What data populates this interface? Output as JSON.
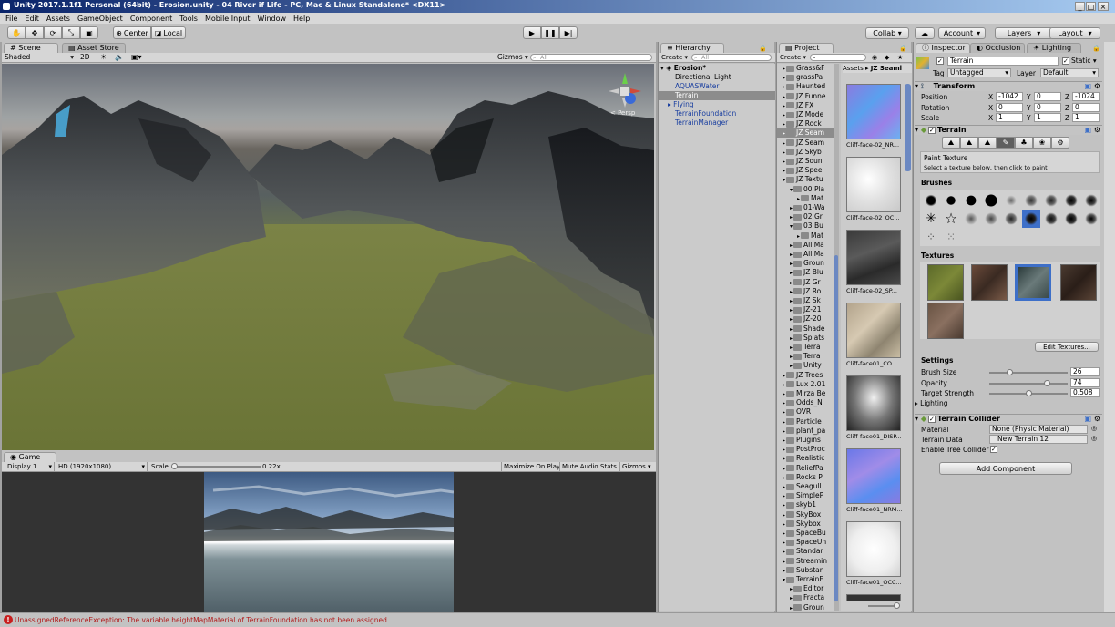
{
  "window": {
    "title": "Unity 2017.1.1f1 Personal (64bit) - Erosion.unity - 04 River if Life - PC, Mac & Linux Standalone* <DX11>"
  },
  "menu": [
    "File",
    "Edit",
    "Assets",
    "GameObject",
    "Component",
    "Tools",
    "Mobile Input",
    "Window",
    "Help"
  ],
  "toolbar": {
    "center": "Center",
    "local": "Local",
    "collab": "Collab ▾",
    "account": "Account",
    "layers": "Layers",
    "layout": "Layout"
  },
  "scene": {
    "tab": "Scene",
    "asset_store_tab": "Asset Store",
    "shading": "Shaded",
    "mode_2d": "2D",
    "gizmos": "Gizmos",
    "search_placeholder": "All",
    "persp": "< Persp"
  },
  "game": {
    "tab": "Game",
    "display": "Display 1",
    "resolution": "HD (1920x1080)",
    "scale_label": "Scale",
    "scale_value": "0.22x",
    "maximize": "Maximize On Play",
    "mute": "Mute Audio",
    "stats": "Stats",
    "gizmos": "Gizmos"
  },
  "hierarchy": {
    "tab": "Hierarchy",
    "create": "Create",
    "search": "All",
    "scene": "Erosion*",
    "items": [
      "Directional Light",
      "AQUASWater",
      "Terrain",
      "Flying",
      "TerrainFoundation",
      "TerrainManager"
    ]
  },
  "project": {
    "tab": "Project",
    "create": "Create",
    "path": [
      "Assets",
      "JZ Seaml"
    ],
    "folders": [
      "Grass&F",
      "grassPa",
      "Haunted",
      "JZ Funne",
      "JZ FX",
      "JZ Mode",
      "JZ Rock",
      "JZ Seam",
      "JZ Seam",
      "JZ Skyb",
      "JZ Soun",
      "JZ Spee",
      "JZ Textu",
      "00 Pla",
      "Mat",
      "01-Wa",
      "02 Gr",
      "03 Bu",
      "Mat",
      "All Ma",
      "All Ma",
      "Groun",
      "JZ Blu",
      "JZ Gr",
      "JZ Ro",
      "JZ Sk",
      "JZ-21",
      "JZ-20",
      "Shade",
      "Splats",
      "Terra",
      "Terra",
      "Unity",
      "JZ Trees",
      "Lux 2.01",
      "Mirza Be",
      "Odds_N",
      "OVR",
      "Particle",
      "plant_pa",
      "Plugins",
      "PostProc",
      "Realistic",
      "ReliefPa",
      "Rocks P",
      "Seagull",
      "SimpleP",
      "skyb1",
      "SkyBox",
      "Skybox",
      "SpaceBu",
      "SpaceUn",
      "Standar",
      "Streamin",
      "Substan",
      "TerrainF",
      "Editor",
      "Fracta",
      "Groun"
    ],
    "assets": [
      "Cliff-face-02_NR...",
      "Cliff-face-02_OC...",
      "Cliff-face-02_SP...",
      "Cliff-face01_CO...",
      "Cliff-face01_DISP...",
      "Cliff-face01_NRM...",
      "Cliff-face01_OCC..."
    ]
  },
  "inspector": {
    "tabs": [
      "Inspector",
      "Occlusion",
      "Lighting"
    ],
    "name": "Terrain",
    "static": "Static",
    "tag_label": "Tag",
    "tag": "Untagged",
    "layer_label": "Layer",
    "layer": "Default",
    "transform": {
      "title": "Transform",
      "position_label": "Position",
      "rotation_label": "Rotation",
      "scale_label": "Scale",
      "pos": [
        "-1042",
        "0",
        "-1024"
      ],
      "rot": [
        "0",
        "0",
        "0"
      ],
      "scl": [
        "1",
        "1",
        "1"
      ],
      "axes": [
        "X",
        "Y",
        "Z"
      ]
    },
    "terrain": {
      "title": "Terrain",
      "paint_title": "Paint Texture",
      "paint_hint": "Select a texture below, then click to paint",
      "brushes_label": "Brushes",
      "textures_label": "Textures",
      "edit_textures": "Edit Textures...",
      "settings_label": "Settings",
      "brush_size_label": "Brush Size",
      "brush_size": "26",
      "opacity_label": "Opacity",
      "opacity": "74",
      "target_label": "Target Strength",
      "target": "0.508",
      "lighting_label": "Lighting"
    },
    "collider": {
      "title": "Terrain Collider",
      "material_label": "Material",
      "material": "None (Physic Material)",
      "data_label": "Terrain Data",
      "data": "New Terrain 12",
      "tree_label": "Enable Tree Collider"
    },
    "add_component": "Add Component"
  },
  "status": {
    "error": "UnassignedReferenceException: The variable heightMapMaterial of TerrainFoundation has not been assigned."
  },
  "colors": {
    "selection": "#3d6fc8",
    "title_bar": "#0a246a",
    "error": "#b11a1a"
  }
}
